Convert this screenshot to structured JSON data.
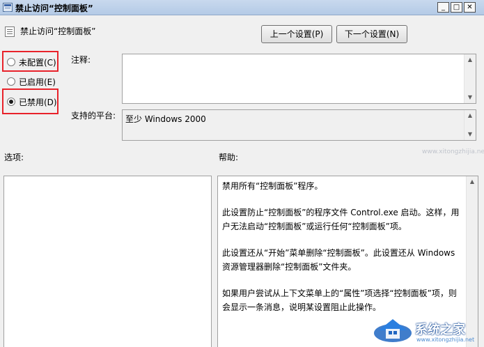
{
  "window": {
    "title": "禁止访问“控制面板”",
    "buttons": {
      "minimize": "_",
      "maximize": "□",
      "close": "✕"
    }
  },
  "header": {
    "policy_name": "禁止访问“控制面板”",
    "prev_button": "上一个设置(P)",
    "next_button": "下一个设置(N)"
  },
  "options": {
    "not_configured": {
      "label": "未配置(C)",
      "selected": false
    },
    "enabled": {
      "label": "已启用(E)",
      "selected": false
    },
    "disabled": {
      "label": "已禁用(D)",
      "selected": true
    }
  },
  "comment": {
    "label": "注释:",
    "value": ""
  },
  "platform": {
    "label": "支持的平台:",
    "value": "至少 Windows 2000"
  },
  "sections": {
    "options_label": "选项:",
    "help_label": "帮助:"
  },
  "help": {
    "paragraphs": [
      "禁用所有“控制面板”程序。",
      "此设置防止“控制面板”的程序文件 Control.exe 启动。这样，用户无法启动“控制面板”或运行任何“控制面板”项。",
      "此设置还从“开始”菜单删除“控制面板”。此设置还从 Windows 资源管理器删除“控制面板”文件夹。",
      "如果用户尝试从上下文菜单上的“属性”项选择“控制面板”项，则会显示一条消息，说明某设置阻止此操作。"
    ]
  },
  "watermark": {
    "url": "www.xitongzhijia.net",
    "brand": "系统之家",
    "sub": "www.xitongzhijia.net"
  },
  "colors": {
    "highlight": "#e8222a",
    "titlebar": "#b4cae6"
  },
  "icons": [
    "window-app-icon",
    "policy-setting-icon",
    "scroll-up-icon",
    "scroll-down-icon",
    "watermark-logo-icon"
  ]
}
